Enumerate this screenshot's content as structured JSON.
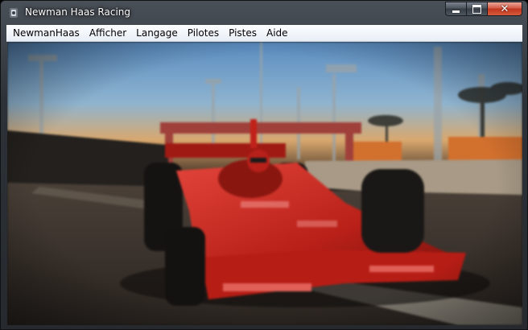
{
  "window": {
    "title": "Newman Haas Racing",
    "icon": "racing-car-app-icon",
    "caption_buttons": [
      "minimize-icon",
      "maximize-icon",
      "close-icon"
    ]
  },
  "menubar": {
    "items": [
      {
        "label": "NewmanHaas"
      },
      {
        "label": "Afficher"
      },
      {
        "label": "Langage"
      },
      {
        "label": "Pilotes"
      },
      {
        "label": "Pistes"
      },
      {
        "label": "Aide"
      }
    ]
  },
  "viewport": {
    "scene": "game-render-indycar",
    "colors": {
      "sky_top": "#5f8fbf",
      "sky_horizon": "#d9a36a",
      "car_red": "#c8261c",
      "barrier_orange": "#d2702e"
    }
  }
}
